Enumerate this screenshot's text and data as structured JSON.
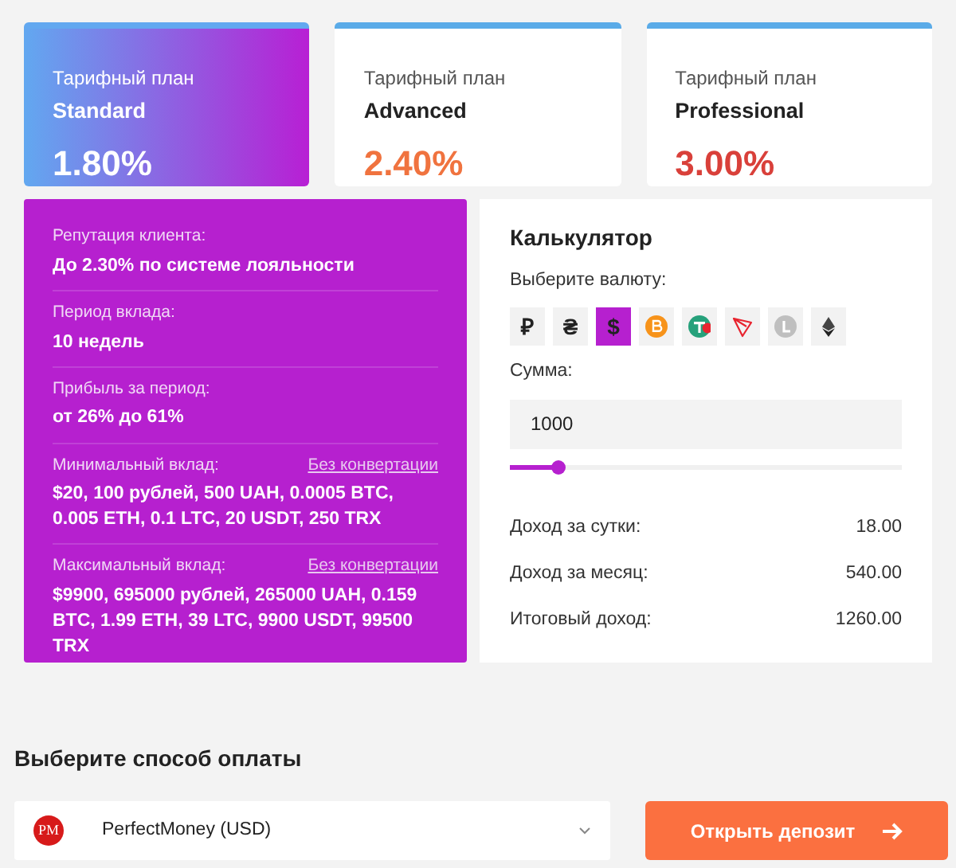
{
  "plans": [
    {
      "label": "Тарифный план",
      "name": "Standard",
      "rate": "1.80%",
      "color": "#ffffff",
      "selected": true
    },
    {
      "label": "Тарифный план",
      "name": "Advanced",
      "rate": "2.40%",
      "color": "#f0733f",
      "selected": false
    },
    {
      "label": "Тарифный план",
      "name": "Professional",
      "rate": "3.00%",
      "color": "#d9403a",
      "selected": false
    }
  ],
  "details": [
    {
      "label": "Репутация клиента:",
      "value": "До 2.30% по системе лояльности"
    },
    {
      "label": "Период вклада:",
      "value": "10 недель"
    },
    {
      "label": "Прибыль за период:",
      "value": "от 26% до 61%"
    },
    {
      "label": "Минимальный вклад:",
      "link": "Без конвертации",
      "value": "$20, 100 рублей, 500 UAH, 0.0005 BTC, 0.005 ETH, 0.1 LTC, 20 USDT, 250 TRX"
    },
    {
      "label": "Максимальный вклад:",
      "link": "Без конвертации",
      "value": "$9900, 695000 рублей, 265000 UAH, 0.159 BTC, 1.99 ETH, 39 LTC, 9900 USDT, 99500 TRX"
    }
  ],
  "calculator": {
    "title": "Калькулятор",
    "currency_label": "Выберите валюту:",
    "currencies": [
      {
        "kind": "glyph",
        "symbol": "₽",
        "selected": false
      },
      {
        "kind": "glyph",
        "symbol": "₴",
        "selected": false
      },
      {
        "kind": "glyph",
        "symbol": "$",
        "selected": true
      },
      {
        "kind": "bitcoin",
        "selected": false
      },
      {
        "kind": "tether",
        "selected": false
      },
      {
        "kind": "tron",
        "selected": false
      },
      {
        "kind": "litecoin",
        "selected": false
      },
      {
        "kind": "ethereum",
        "selected": false
      }
    ],
    "amount_label": "Сумма:",
    "amount": "1000",
    "level": 0.12,
    "results": [
      {
        "label": "Доход за сутки:",
        "value": "18.00"
      },
      {
        "label": "Доход за месяц:",
        "value": "540.00"
      },
      {
        "label": "Итоговый доход:",
        "value": "1260.00"
      }
    ]
  },
  "payment": {
    "title": "Выберите способ оплаты",
    "logo_text": "PM",
    "method": "PerfectMoney (USD)",
    "button": "Открыть депозит"
  }
}
